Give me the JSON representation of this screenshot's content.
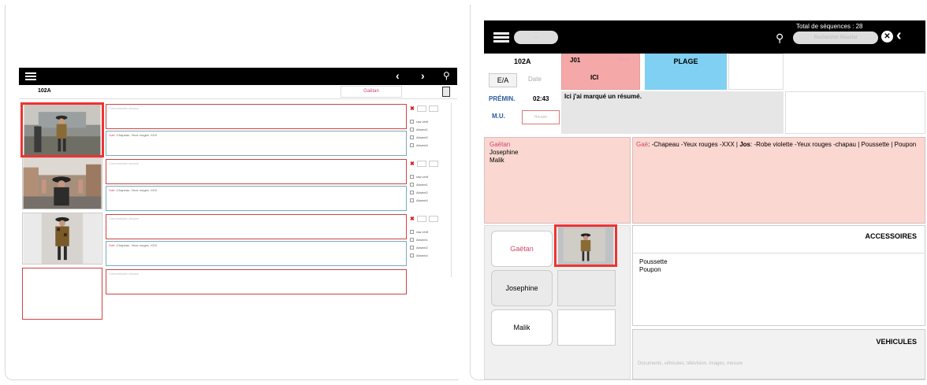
{
  "left": {
    "sequence_code": "102A",
    "selected_character": "Gaëtan",
    "rows": [
      {
        "note_placeholder": "Commentaire séance",
        "desc_pink": "Gaë",
        "desc_rest": " -Chapeau -Yeux rouges -XXX",
        "options": [
          "raw vérif",
          "Absent1",
          "Absent2",
          "Absent4"
        ]
      },
      {
        "note_placeholder": "Commentaire séance",
        "desc_pink": "Gaë",
        "desc_rest": " -Chapeau -Yeux rouges -XXX",
        "options": [
          "raw vérif",
          "Absent1",
          "Absent2",
          "Absent4"
        ]
      },
      {
        "note_placeholder": "Commentaire séance",
        "desc_pink": "Gaë",
        "desc_rest": " -Chapeau -Yeux rouges -XXX",
        "options": [
          "raw vérif",
          "Absent1",
          "Absent2",
          "Absent4"
        ]
      },
      {
        "note_placeholder": "Commentaire séance"
      }
    ]
  },
  "right": {
    "menu_pill": "...",
    "total_sequences": "Total de séquences : 28",
    "search_placeholder": "Rechercher Résultat",
    "sequence_code": "102A",
    "ea_label": "E/A",
    "date_label": "Date",
    "j_label": "J01",
    "j_hint": "Heure",
    "location": "ICI",
    "set": "PLAGE",
    "premin_label": "PRÉMIN.",
    "premin_time": "02:43",
    "summary": "Ici j'ai marqué un résumé.",
    "mu_label": "M.U.",
    "mu_placeholder": "Horaire",
    "names": [
      "Gaëtan",
      "Josephine",
      "Malik"
    ],
    "desc_parts": [
      {
        "text": "Gaë",
        "style": "pink"
      },
      {
        "text": ": -Chapeau -Yeux rouges -XXX | ",
        "style": "normal"
      },
      {
        "text": "Jos",
        "style": "bold"
      },
      {
        "text": ": -Robe violette -Yeux rouges -chapau | Poussette  | Poupon",
        "style": "normal"
      }
    ],
    "characters": [
      "Gaëtan",
      "Josephine",
      "Malik"
    ],
    "accessories_title": "ACCESSOIRES",
    "accessories": [
      "Poussette",
      "Poupon"
    ],
    "vehicles_title": "VEHICULES",
    "vehicles_placeholder": "Documents, véhicules, télévision, images, mesure"
  },
  "colors": {
    "accent_pink": "#d0486e",
    "selection_red": "#e33333",
    "plage_blue": "#7fd0f2",
    "j01_red": "#f4a8a8",
    "names_bg": "#fad7d0"
  }
}
